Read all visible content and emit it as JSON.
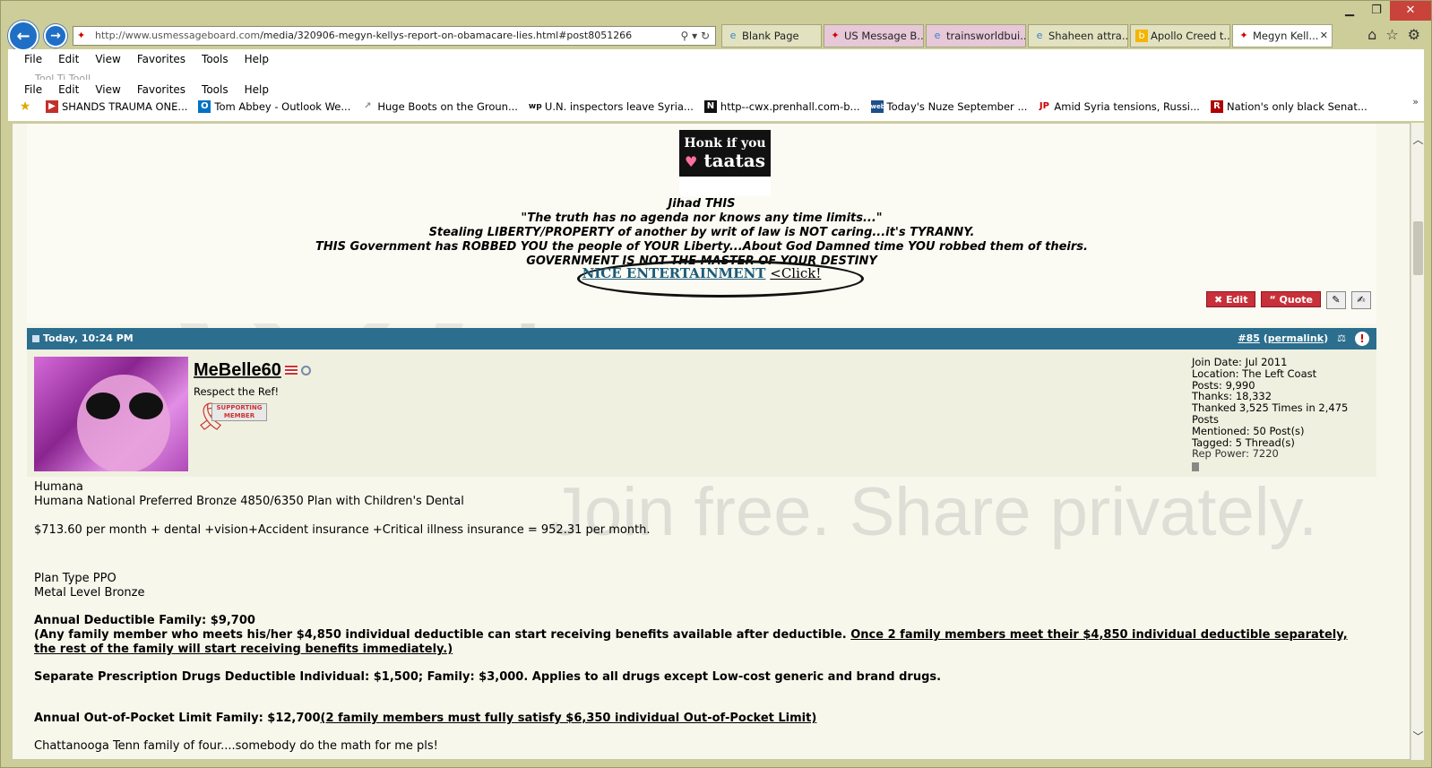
{
  "browser": {
    "url_domain": "http://www.usmessageboard.com",
    "url_path": "/media/320906-megyn-kellys-report-on-obamacare-lies.html#post8051266",
    "tabs": [
      {
        "label": "Blank Page",
        "active": false
      },
      {
        "label": "US Message B...",
        "active": false
      },
      {
        "label": "trainsworldbui...",
        "active": false
      },
      {
        "label": "Shaheen attra...",
        "active": false
      },
      {
        "label": "Apollo Creed t...",
        "active": false
      },
      {
        "label": "Megyn Kell...",
        "active": true
      }
    ],
    "window_controls": {
      "minimize": "▁",
      "maximize": "❐",
      "close": "✕"
    }
  },
  "menus": {
    "menu1": [
      "File",
      "Edit",
      "View",
      "Favorites",
      "Tools",
      "Help"
    ],
    "menu2": [
      "File",
      "Edit",
      "View",
      "Favorites",
      "Tools",
      "Help"
    ],
    "ghost": "Tool Ti Tooll"
  },
  "favorites": [
    {
      "label": "SHANDS TRAUMA ONE...",
      "icon": "youtube-icon",
      "color": "#c4302b"
    },
    {
      "label": "Tom Abbey - Outlook We...",
      "icon": "outlook-icon",
      "color": "#0072c6"
    },
    {
      "label": "Huge Boots on the Groun...",
      "icon": "link-icon",
      "color": "#888888"
    },
    {
      "label": "U.N. inspectors leave Syria...",
      "icon": "wp-icon",
      "color": "#111111"
    },
    {
      "label": "http--cwx.prenhall.com-b...",
      "icon": "n-icon",
      "color": "#111111"
    },
    {
      "label": "Today's Nuze September ...",
      "icon": "web-icon",
      "color": "#1c4f8c"
    },
    {
      "label": "Amid Syria tensions, Russi...",
      "icon": "jp-icon",
      "color": "#c00000"
    },
    {
      "label": "Nation's only black Senat...",
      "icon": "r-icon",
      "color": "#b00000"
    }
  ],
  "signature": {
    "honk_line1": "Honk if you",
    "honk_line2": "taatas",
    "line1": "Jihad THIS",
    "line2": "\"The truth has no agenda nor knows any time limits...\"",
    "line3": "Stealing LIBERTY/PROPERTY of another by writ of law is NOT caring...it's TYRANNY.",
    "line4": "THIS Government has ROBBED YOU the people of YOUR Liberty...About God Damned time YOU robbed them of theirs.",
    "line5": "GOVERNMENT IS NOT THE MASTER OF YOUR DESTINY",
    "link": "NICE ENTERTAINMENT",
    "click": "<Click!"
  },
  "post_actions": {
    "edit": "Edit",
    "quote": "Quote"
  },
  "post": {
    "date": "Today, 10:24 PM",
    "number": "#85",
    "permalink": "permalink",
    "username": "MeBelle60",
    "user_title": "Respect the Ref!",
    "badge": "SUPPORTING MEMBER",
    "stats": [
      "Join Date: Jul 2011",
      "Location: The Left Coast",
      "Posts: 9,990",
      "Thanks: 18,332",
      "Thanked 3,525 Times in 2,475 Posts",
      "Mentioned: 50 Post(s)",
      "Tagged: 5 Thread(s)",
      "Rep Power: 7220"
    ],
    "body": {
      "p1": "Humana",
      "p2": "Humana National Preferred Bronze 4850/6350 Plan with Children's Dental",
      "p3": "$713.60 per month + dental +vision+Accident insurance +Critical illness insurance = 952.31 per month.",
      "p4": "Plan Type PPO",
      "p5": "Metal Level Bronze",
      "p6": "Annual Deductible Family: $9,700",
      "p7a": "(Any family member who meets his/her $4,850 individual deductible can start receiving benefits available after deductible. ",
      "p7b": "Once 2 family members meet their $4,850 individual deductible separately, the rest of the family will start receiving benefits immediately.)",
      "p8": "Separate Prescription Drugs Deductible Individual: $1,500; Family: $3,000. Applies to all drugs except Low-cost generic and brand drugs.",
      "p9a": "Annual Out-of-Pocket Limit Family: $12,700",
      "p9b": "(2 family members must fully satisfy $6,350 individual Out-of-Pocket Limit)",
      "p10": "Chattanooga Tenn family of four....somebody do the math for me pls!"
    }
  },
  "watermark": {
    "top": "photobucket",
    "bottom": "Join free. Share privately."
  }
}
